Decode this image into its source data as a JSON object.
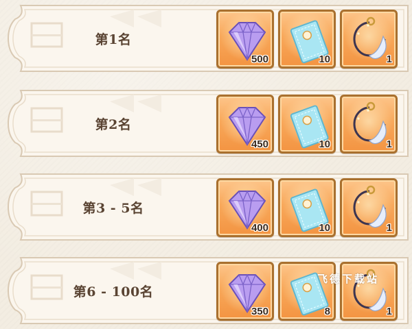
{
  "ranks": [
    {
      "label": "第1名",
      "rewards": [
        {
          "icon": "gem-icon",
          "quantity": "500"
        },
        {
          "icon": "ticket-icon",
          "quantity": "10"
        },
        {
          "icon": "ring-icon",
          "quantity": "1"
        }
      ]
    },
    {
      "label": "第2名",
      "rewards": [
        {
          "icon": "gem-icon",
          "quantity": "450"
        },
        {
          "icon": "ticket-icon",
          "quantity": "10"
        },
        {
          "icon": "ring-icon",
          "quantity": "1"
        }
      ]
    },
    {
      "label": "第3 - 5名",
      "rewards": [
        {
          "icon": "gem-icon",
          "quantity": "400"
        },
        {
          "icon": "ticket-icon",
          "quantity": "10"
        },
        {
          "icon": "ring-icon",
          "quantity": "1"
        }
      ]
    },
    {
      "label": "第6 - 100名",
      "rewards": [
        {
          "icon": "gem-icon",
          "quantity": "350"
        },
        {
          "icon": "ticket-icon",
          "quantity": "8"
        },
        {
          "icon": "ring-icon",
          "quantity": "1"
        }
      ]
    }
  ],
  "watermark": "飞德下载站",
  "colors": {
    "panel": "#fbf6ee",
    "panel_border": "#d9c9b3",
    "item_frame": "#a9702e",
    "item_fill": "#f8a85a",
    "label_text": "#5a4433"
  }
}
